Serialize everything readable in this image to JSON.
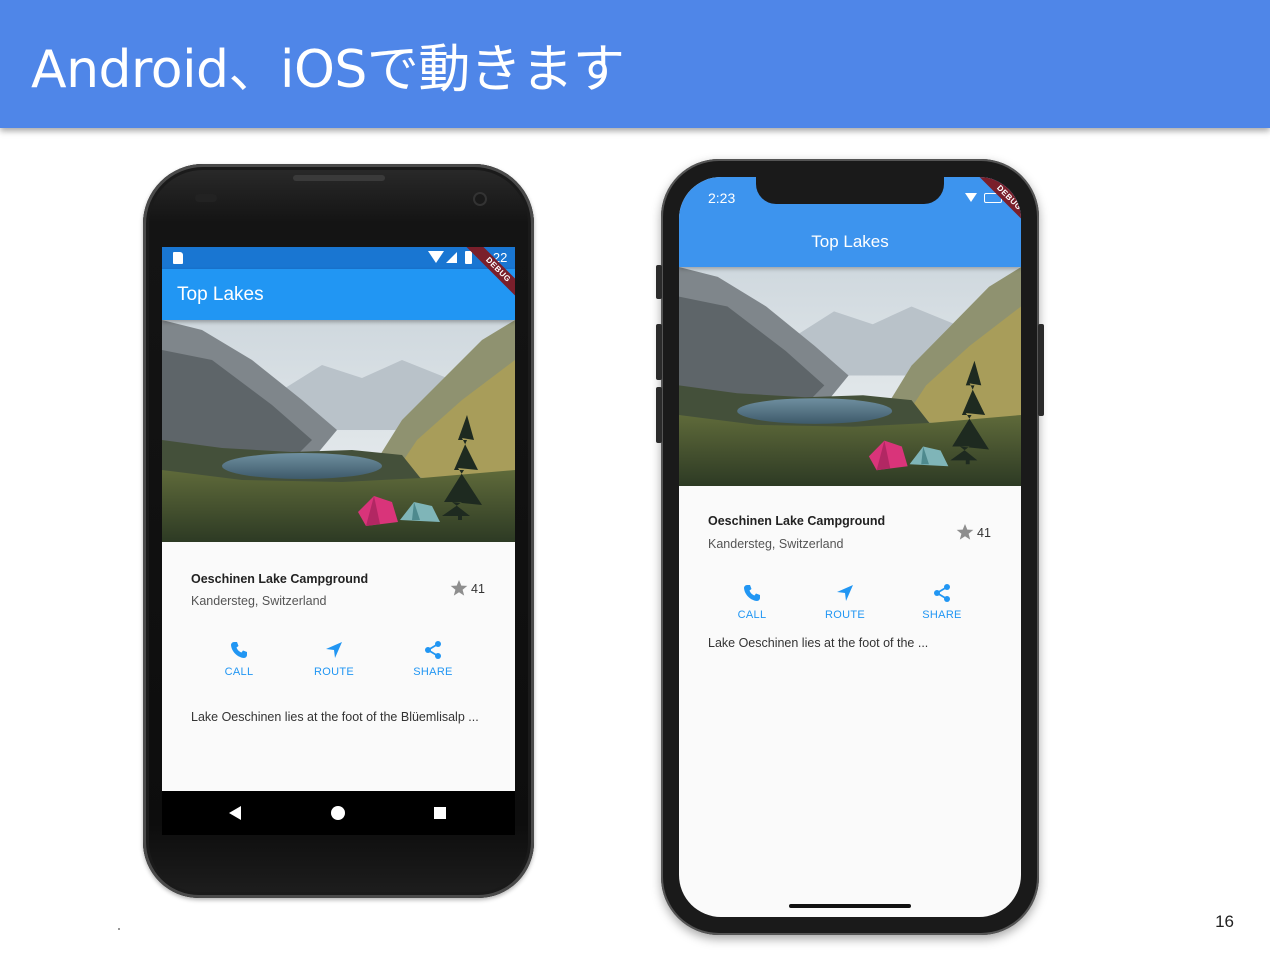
{
  "slide": {
    "title": "Android、iOSで動きます",
    "page_number": "16"
  },
  "android": {
    "status_time": "2:22",
    "debug_banner": "DEBUG",
    "appbar_title": "Top Lakes",
    "place_name": "Oeschinen Lake Campground",
    "place_location": "Kandersteg, Switzerland",
    "star_count": "41",
    "actions": [
      {
        "label": "CALL",
        "icon": "phone-icon"
      },
      {
        "label": "ROUTE",
        "icon": "navigation-icon"
      },
      {
        "label": "SHARE",
        "icon": "share-icon"
      }
    ],
    "description": "Lake Oeschinen lies at the foot of the Blüemlisalp ..."
  },
  "ios": {
    "status_time": "2:23",
    "debug_banner": "DEBUG",
    "appbar_title": "Top Lakes",
    "place_name": "Oeschinen Lake Campground",
    "place_location": "Kandersteg, Switzerland",
    "star_count": "41",
    "actions": [
      {
        "label": "CALL",
        "icon": "phone-icon"
      },
      {
        "label": "ROUTE",
        "icon": "navigation-icon"
      },
      {
        "label": "SHARE",
        "icon": "share-icon"
      }
    ],
    "description": "Lake Oeschinen lies at the foot of the ..."
  },
  "colors": {
    "slide_header": "#4f86e8",
    "android_statusbar": "#1976d2",
    "android_appbar": "#2196f3",
    "ios_appbar": "#3d94ee",
    "action_blue": "#2196f3",
    "star_gray": "#8e8e8e"
  }
}
